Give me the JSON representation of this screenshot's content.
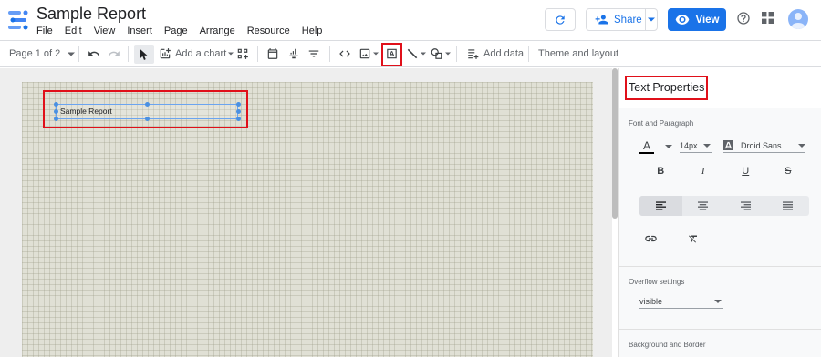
{
  "app": {
    "title": "Sample Report",
    "menu": [
      "File",
      "Edit",
      "View",
      "Insert",
      "Page",
      "Arrange",
      "Resource",
      "Help"
    ]
  },
  "header": {
    "share_label": "Share",
    "view_label": "View"
  },
  "toolbar": {
    "page_indicator": "Page 1 of 2",
    "add_chart_label": "Add a chart",
    "add_data_label": "Add data",
    "theme_label": "Theme and layout"
  },
  "canvas": {
    "text_element": "Sample Report"
  },
  "panel": {
    "title": "Text Properties",
    "font_section": "Font and Paragraph",
    "font_color": "A",
    "font_size": "14px",
    "font_family": "Droid Sans",
    "bold": "B",
    "italic": "I",
    "underline": "U",
    "strike": "S",
    "overflow_section": "Overflow settings",
    "overflow_value": "visible",
    "background_section": "Background and Border"
  },
  "colors": {
    "accent": "#1a73e8",
    "highlight": "#e0101a"
  }
}
